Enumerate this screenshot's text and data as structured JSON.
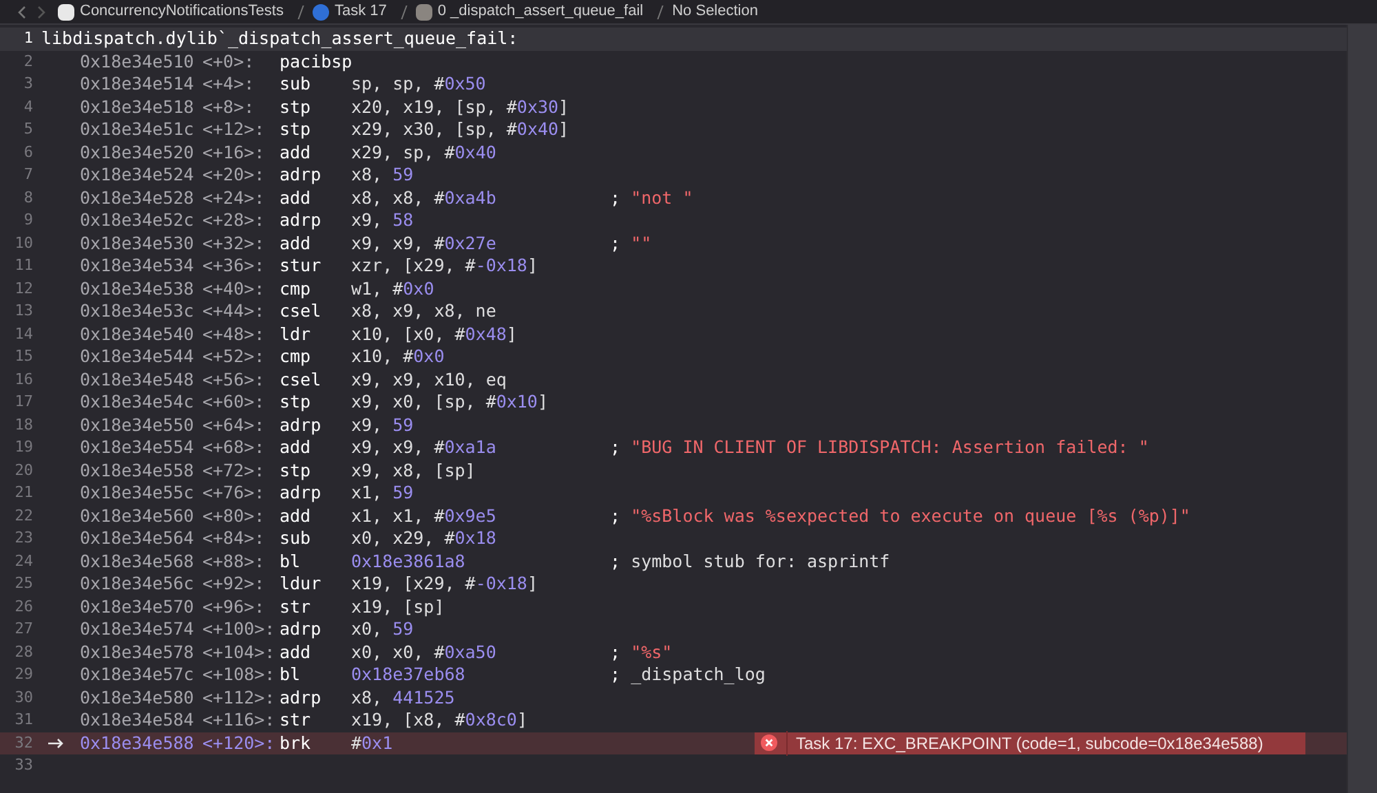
{
  "breadcrumb": {
    "items": [
      {
        "text": "ConcurrencyNotificationsTests",
        "kind": "project"
      },
      {
        "text": "Task 17",
        "kind": "thread"
      },
      {
        "text": "0 _dispatch_assert_queue_fail",
        "kind": "frame"
      },
      {
        "text": "No Selection",
        "kind": "plain"
      }
    ]
  },
  "lines": [
    {
      "number": "1",
      "kind": "label",
      "text": "libdispatch.dylib`_dispatch_assert_queue_fail:"
    },
    {
      "number": "2",
      "kind": "instruction",
      "current": false,
      "address": "0x18e34e510",
      "offset": "<+0>:",
      "mnemonic": "pacibsp"
    },
    {
      "number": "3",
      "kind": "instruction",
      "current": false,
      "address": "0x18e34e514",
      "offset": "<+4>:",
      "mnemonic": "sub",
      "operands": [
        {
          "text": "sp, sp, #",
          "kind": "plain"
        },
        {
          "text": "0x50",
          "kind": "number"
        }
      ]
    },
    {
      "number": "4",
      "kind": "instruction",
      "current": false,
      "address": "0x18e34e518",
      "offset": "<+8>:",
      "mnemonic": "stp",
      "operands": [
        {
          "text": "x20, x19, [sp, #",
          "kind": "plain"
        },
        {
          "text": "0x30",
          "kind": "number"
        },
        {
          "text": "]",
          "kind": "plain"
        }
      ]
    },
    {
      "number": "5",
      "kind": "instruction",
      "current": false,
      "address": "0x18e34e51c",
      "offset": "<+12>:",
      "mnemonic": "stp",
      "operands": [
        {
          "text": "x29, x30, [sp, #",
          "kind": "plain"
        },
        {
          "text": "0x40",
          "kind": "number"
        },
        {
          "text": "]",
          "kind": "plain"
        }
      ]
    },
    {
      "number": "6",
      "kind": "instruction",
      "current": false,
      "address": "0x18e34e520",
      "offset": "<+16>:",
      "mnemonic": "add",
      "operands": [
        {
          "text": "x29, sp, #",
          "kind": "plain"
        },
        {
          "text": "0x40",
          "kind": "number"
        }
      ]
    },
    {
      "number": "7",
      "kind": "instruction",
      "current": false,
      "address": "0x18e34e524",
      "offset": "<+20>:",
      "mnemonic": "adrp",
      "operands": [
        {
          "text": "x8, ",
          "kind": "plain"
        },
        {
          "text": "59",
          "kind": "number"
        }
      ]
    },
    {
      "number": "8",
      "kind": "instruction",
      "current": false,
      "address": "0x18e34e528",
      "offset": "<+24>:",
      "mnemonic": "add",
      "operands": [
        {
          "text": "x8, x8, #",
          "kind": "plain"
        },
        {
          "text": "0xa4b",
          "kind": "number"
        }
      ],
      "comment": {
        "marker": ";",
        "text": "\"not \"",
        "kind": "string"
      }
    },
    {
      "number": "9",
      "kind": "instruction",
      "current": false,
      "address": "0x18e34e52c",
      "offset": "<+28>:",
      "mnemonic": "adrp",
      "operands": [
        {
          "text": "x9, ",
          "kind": "plain"
        },
        {
          "text": "58",
          "kind": "number"
        }
      ]
    },
    {
      "number": "10",
      "kind": "instruction",
      "current": false,
      "address": "0x18e34e530",
      "offset": "<+32>:",
      "mnemonic": "add",
      "operands": [
        {
          "text": "x9, x9, #",
          "kind": "plain"
        },
        {
          "text": "0x27e",
          "kind": "number"
        }
      ],
      "comment": {
        "marker": ";",
        "text": "\"\"",
        "kind": "string"
      }
    },
    {
      "number": "11",
      "kind": "instruction",
      "current": false,
      "address": "0x18e34e534",
      "offset": "<+36>:",
      "mnemonic": "stur",
      "operands": [
        {
          "text": "xzr, [x29, #",
          "kind": "plain"
        },
        {
          "text": "-0x18",
          "kind": "number"
        },
        {
          "text": "]",
          "kind": "plain"
        }
      ]
    },
    {
      "number": "12",
      "kind": "instruction",
      "current": false,
      "address": "0x18e34e538",
      "offset": "<+40>:",
      "mnemonic": "cmp",
      "operands": [
        {
          "text": "w1, #",
          "kind": "plain"
        },
        {
          "text": "0x0",
          "kind": "number"
        }
      ]
    },
    {
      "number": "13",
      "kind": "instruction",
      "current": false,
      "address": "0x18e34e53c",
      "offset": "<+44>:",
      "mnemonic": "csel",
      "operands": [
        {
          "text": "x8, x9, x8, ne",
          "kind": "plain"
        }
      ]
    },
    {
      "number": "14",
      "kind": "instruction",
      "current": false,
      "address": "0x18e34e540",
      "offset": "<+48>:",
      "mnemonic": "ldr",
      "operands": [
        {
          "text": "x10, [x0, #",
          "kind": "plain"
        },
        {
          "text": "0x48",
          "kind": "number"
        },
        {
          "text": "]",
          "kind": "plain"
        }
      ]
    },
    {
      "number": "15",
      "kind": "instruction",
      "current": false,
      "address": "0x18e34e544",
      "offset": "<+52>:",
      "mnemonic": "cmp",
      "operands": [
        {
          "text": "x10, #",
          "kind": "plain"
        },
        {
          "text": "0x0",
          "kind": "number"
        }
      ]
    },
    {
      "number": "16",
      "kind": "instruction",
      "current": false,
      "address": "0x18e34e548",
      "offset": "<+56>:",
      "mnemonic": "csel",
      "operands": [
        {
          "text": "x9, x9, x10, eq",
          "kind": "plain"
        }
      ]
    },
    {
      "number": "17",
      "kind": "instruction",
      "current": false,
      "address": "0x18e34e54c",
      "offset": "<+60>:",
      "mnemonic": "stp",
      "operands": [
        {
          "text": "x9, x0, [sp, #",
          "kind": "plain"
        },
        {
          "text": "0x10",
          "kind": "number"
        },
        {
          "text": "]",
          "kind": "plain"
        }
      ]
    },
    {
      "number": "18",
      "kind": "instruction",
      "current": false,
      "address": "0x18e34e550",
      "offset": "<+64>:",
      "mnemonic": "adrp",
      "operands": [
        {
          "text": "x9, ",
          "kind": "plain"
        },
        {
          "text": "59",
          "kind": "number"
        }
      ]
    },
    {
      "number": "19",
      "kind": "instruction",
      "current": false,
      "address": "0x18e34e554",
      "offset": "<+68>:",
      "mnemonic": "add",
      "operands": [
        {
          "text": "x9, x9, #",
          "kind": "plain"
        },
        {
          "text": "0xa1a",
          "kind": "number"
        }
      ],
      "comment": {
        "marker": ";",
        "text": "\"BUG IN CLIENT OF LIBDISPATCH: Assertion failed: \"",
        "kind": "string"
      }
    },
    {
      "number": "20",
      "kind": "instruction",
      "current": false,
      "address": "0x18e34e558",
      "offset": "<+72>:",
      "mnemonic": "stp",
      "operands": [
        {
          "text": "x9, x8, [sp]",
          "kind": "plain"
        }
      ]
    },
    {
      "number": "21",
      "kind": "instruction",
      "current": false,
      "address": "0x18e34e55c",
      "offset": "<+76>:",
      "mnemonic": "adrp",
      "operands": [
        {
          "text": "x1, ",
          "kind": "plain"
        },
        {
          "text": "59",
          "kind": "number"
        }
      ]
    },
    {
      "number": "22",
      "kind": "instruction",
      "current": false,
      "address": "0x18e34e560",
      "offset": "<+80>:",
      "mnemonic": "add",
      "operands": [
        {
          "text": "x1, x1, #",
          "kind": "plain"
        },
        {
          "text": "0x9e5",
          "kind": "number"
        }
      ],
      "comment": {
        "marker": ";",
        "text": "\"%sBlock was %sexpected to execute on queue [%s (%p)]\"",
        "kind": "string"
      }
    },
    {
      "number": "23",
      "kind": "instruction",
      "current": false,
      "address": "0x18e34e564",
      "offset": "<+84>:",
      "mnemonic": "sub",
      "operands": [
        {
          "text": "x0, x29, #",
          "kind": "plain"
        },
        {
          "text": "0x18",
          "kind": "number"
        }
      ]
    },
    {
      "number": "24",
      "kind": "instruction",
      "current": false,
      "address": "0x18e34e568",
      "offset": "<+88>:",
      "mnemonic": "bl",
      "operands": [
        {
          "text": "0x18e3861a8",
          "kind": "number"
        }
      ],
      "comment": {
        "marker": ";",
        "text": "symbol stub for: asprintf",
        "kind": "plain"
      }
    },
    {
      "number": "25",
      "kind": "instruction",
      "current": false,
      "address": "0x18e34e56c",
      "offset": "<+92>:",
      "mnemonic": "ldur",
      "operands": [
        {
          "text": "x19, [x29, #",
          "kind": "plain"
        },
        {
          "text": "-0x18",
          "kind": "number"
        },
        {
          "text": "]",
          "kind": "plain"
        }
      ]
    },
    {
      "number": "26",
      "kind": "instruction",
      "current": false,
      "address": "0x18e34e570",
      "offset": "<+96>:",
      "mnemonic": "str",
      "operands": [
        {
          "text": "x19, [sp]",
          "kind": "plain"
        }
      ]
    },
    {
      "number": "27",
      "kind": "instruction",
      "current": false,
      "address": "0x18e34e574",
      "offset": "<+100>:",
      "mnemonic": "adrp",
      "operands": [
        {
          "text": "x0, ",
          "kind": "plain"
        },
        {
          "text": "59",
          "kind": "number"
        }
      ]
    },
    {
      "number": "28",
      "kind": "instruction",
      "current": false,
      "address": "0x18e34e578",
      "offset": "<+104>:",
      "mnemonic": "add",
      "operands": [
        {
          "text": "x0, x0, #",
          "kind": "plain"
        },
        {
          "text": "0xa50",
          "kind": "number"
        }
      ],
      "comment": {
        "marker": ";",
        "text": "\"%s\"",
        "kind": "string"
      }
    },
    {
      "number": "29",
      "kind": "instruction",
      "current": false,
      "address": "0x18e34e57c",
      "offset": "<+108>:",
      "mnemonic": "bl",
      "operands": [
        {
          "text": "0x18e37eb68",
          "kind": "number"
        }
      ],
      "comment": {
        "marker": ";",
        "text": "_dispatch_log",
        "kind": "plain"
      }
    },
    {
      "number": "30",
      "kind": "instruction",
      "current": false,
      "address": "0x18e34e580",
      "offset": "<+112>:",
      "mnemonic": "adrp",
      "operands": [
        {
          "text": "x8, ",
          "kind": "plain"
        },
        {
          "text": "441525",
          "kind": "number"
        }
      ]
    },
    {
      "number": "31",
      "kind": "instruction",
      "current": false,
      "address": "0x18e34e584",
      "offset": "<+116>:",
      "mnemonic": "str",
      "operands": [
        {
          "text": "x19, [x8, #",
          "kind": "plain"
        },
        {
          "text": "0x8c0",
          "kind": "number"
        },
        {
          "text": "]",
          "kind": "plain"
        }
      ]
    },
    {
      "number": "32",
      "kind": "instruction",
      "current": true,
      "address": "0x18e34e588",
      "offset": "<+120>:",
      "mnemonic": "brk",
      "operands": [
        {
          "text": "#",
          "kind": "plain"
        },
        {
          "text": "0x1",
          "kind": "number"
        }
      ],
      "annotation": {
        "text": "Task 17: EXC_BREAKPOINT (code=1, subcode=0x18e34e588)",
        "kind": "error"
      }
    },
    {
      "number": "33",
      "kind": "empty"
    }
  ]
}
